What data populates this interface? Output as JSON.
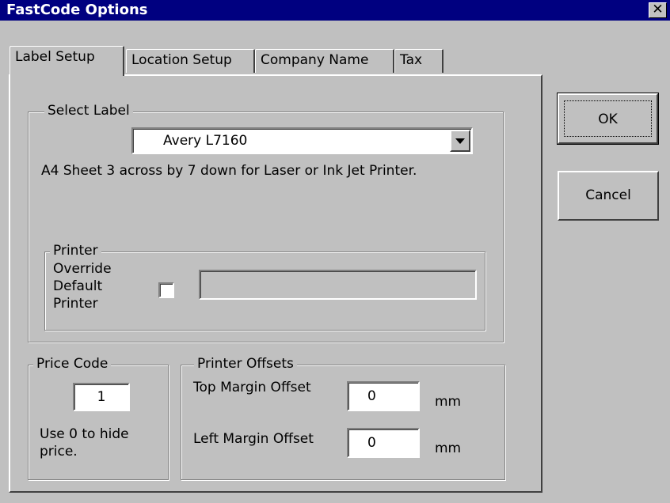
{
  "window": {
    "title": "FastCode Options"
  },
  "tabs": [
    {
      "label": "Label Setup"
    },
    {
      "label": "Location Setup"
    },
    {
      "label": "Company Name"
    },
    {
      "label": "Tax"
    }
  ],
  "select_label": {
    "legend": "Select Label",
    "dropdown_value": "Avery L7160",
    "description": "A4 Sheet 3 across by 7 down for Laser or Ink Jet Printer."
  },
  "printer": {
    "legend": "Printer",
    "override_label_line1": "Override",
    "override_label_line2": "Default",
    "override_label_line3": "Printer",
    "override_checked": false,
    "printer_name": ""
  },
  "price_code": {
    "legend": "Price Code",
    "value": "1",
    "hint_line1": "Use 0 to hide",
    "hint_line2": "price."
  },
  "printer_offsets": {
    "legend": "Printer Offsets",
    "top_label": "Top Margin Offset",
    "top_value": "0",
    "top_unit": "mm",
    "left_label": "Left Margin Offset",
    "left_value": "0",
    "left_unit": "mm"
  },
  "buttons": {
    "ok": "OK",
    "cancel": "Cancel"
  }
}
